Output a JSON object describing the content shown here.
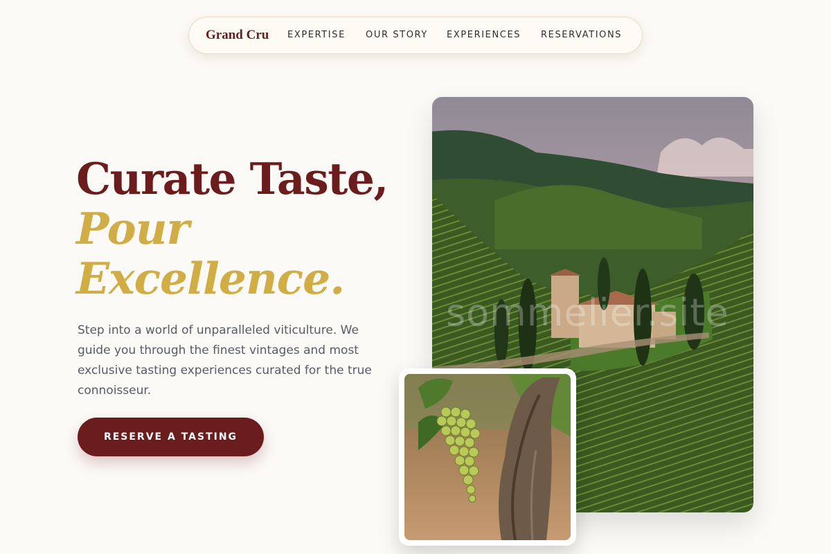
{
  "nav": {
    "brand": "Grand Cru",
    "links": [
      "EXPERTISE",
      "OUR STORY",
      "EXPERIENCES",
      "RESERVATIONS"
    ]
  },
  "hero": {
    "headline_line1": "Curate Taste,",
    "headline_line2": "Pour",
    "headline_line3": "Excellence.",
    "description": "Step into a world of unparalleled viticulture. We guide you through the finest vintages and most exclusive tasting experiences curated for the true connoisseur.",
    "cta_label": "RESERVE A TASTING"
  },
  "media": {
    "landscape_watermark": "sommelier.site"
  },
  "colors": {
    "burgundy": "#6b1d1d",
    "gold": "#d1ad46",
    "background": "#fcfaf6"
  }
}
